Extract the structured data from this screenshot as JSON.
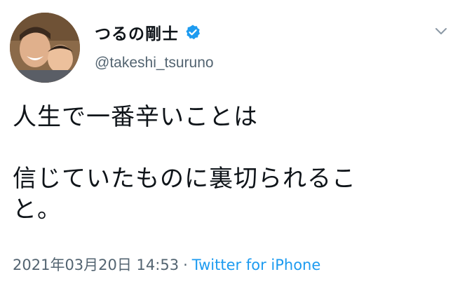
{
  "user": {
    "display_name": "つるの剛士",
    "handle": "@takeshi_tsuruno",
    "verified": true
  },
  "tweet": {
    "lines": [
      "人生で一番辛いことは",
      "",
      "信じていたものに裏切られるこ",
      "と。"
    ]
  },
  "meta": {
    "timestamp": "2021年03月20日 14:53",
    "separator": "·",
    "source": "Twitter for iPhone"
  },
  "icons": {
    "verified": "verified-badge-icon",
    "menu": "chevron-down-icon"
  },
  "colors": {
    "verified_blue": "#1d9bf0",
    "link_blue": "#1d9bf0",
    "secondary_text": "#536471",
    "primary_text": "#0f1419"
  }
}
